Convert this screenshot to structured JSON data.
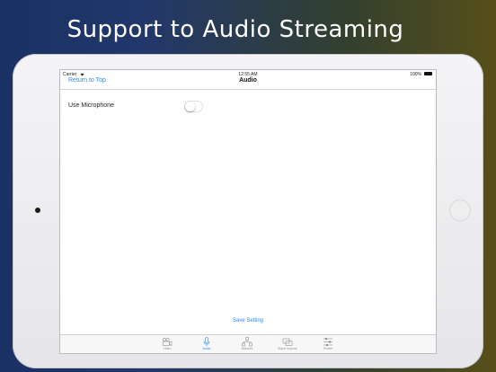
{
  "headline": "Support to Audio Streaming",
  "status_bar": {
    "carrier": "Carrier",
    "time": "12:55 AM",
    "battery": "100%"
  },
  "navbar": {
    "back_label": "Return to Top",
    "title": "Audio"
  },
  "settings": {
    "use_microphone": {
      "label": "Use Microphone",
      "enabled": false
    }
  },
  "save_label": "Save Setting",
  "tabs": [
    {
      "label": "Video",
      "icon": "video-camera-icon",
      "active": false
    },
    {
      "label": "Audio",
      "icon": "microphone-icon",
      "active": true
    },
    {
      "label": "Network",
      "icon": "network-icon",
      "active": false
    },
    {
      "label": "Super Impose",
      "icon": "super-impose-icon",
      "active": false
    },
    {
      "label": "Preset",
      "icon": "sliders-icon",
      "active": false
    }
  ],
  "colors": {
    "accent": "#2a86ff",
    "inactive": "#8e8e93"
  }
}
